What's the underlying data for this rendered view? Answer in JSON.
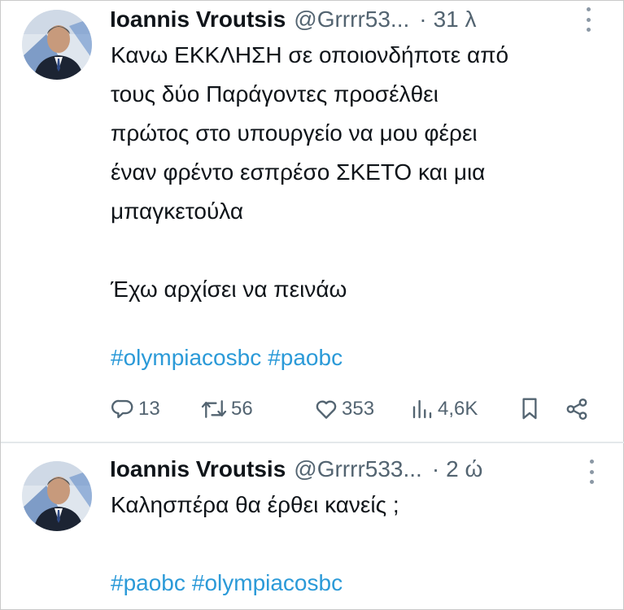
{
  "tweets": [
    {
      "author_name": "Ioannis Vroutsis",
      "handle": "@Grrrr53...",
      "separator": "·",
      "time": "31 λ",
      "text_lines": [
        "Κανω ΕΚΚΛΗΣΗ σε οποιονδήποτε από",
        "τους δύο Παράγοντες προσέλθει",
        "πρώτος στο υπουργείο να μου φέρει",
        "έναν φρέντο εσπρέσο ΣΚΕΤΟ και μια",
        "μπαγκετούλα",
        "Έχω αρχίσει να πεινάω"
      ],
      "hashtags": [
        "#olympiacosbc",
        "#paobc"
      ],
      "stats": {
        "replies": "13",
        "retweets": "56",
        "likes": "353",
        "views": "4,6K"
      }
    },
    {
      "author_name": "Ioannis Vroutsis",
      "handle": "@Grrrr533...",
      "separator": "·",
      "time": "2 ώ",
      "text_lines": [
        "Καλησπέρα θα έρθει κανείς ;"
      ],
      "hashtags": [
        "#paobc",
        "#olympiacosbc"
      ]
    }
  ],
  "icons": {
    "more": "more-dots-icon",
    "reply": "reply-icon",
    "retweet": "retweet-icon",
    "like": "heart-icon",
    "views": "views-icon",
    "bookmark": "bookmark-icon",
    "share": "share-icon"
  },
  "colors": {
    "text": "#0f1419",
    "secondary": "#536471",
    "hashtag": "#2b9ad8",
    "divider": "#e4e8eb"
  }
}
